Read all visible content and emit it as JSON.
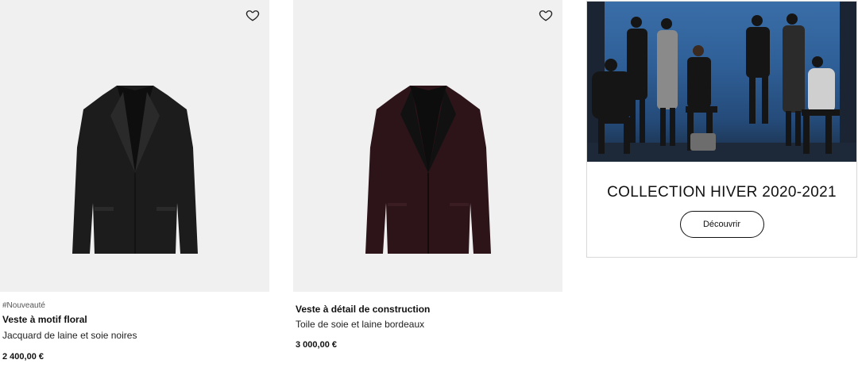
{
  "products": [
    {
      "tag": "#Nouveauté",
      "name": "Veste à motif floral",
      "description": "Jacquard de laine et soie noires",
      "price": "2 400,00 €",
      "jacket_color": "#1c1c1c"
    },
    {
      "tag": "",
      "name": "Veste à détail de construction",
      "description": "Toile de soie et laine bordeaux",
      "price": "3 000,00 €",
      "jacket_color": "#2d1419"
    }
  ],
  "icons": {
    "favorite": "heart-outline-icon"
  },
  "promo": {
    "title": "COLLECTION HIVER 2020-2021",
    "button_label": "Découvrir"
  }
}
